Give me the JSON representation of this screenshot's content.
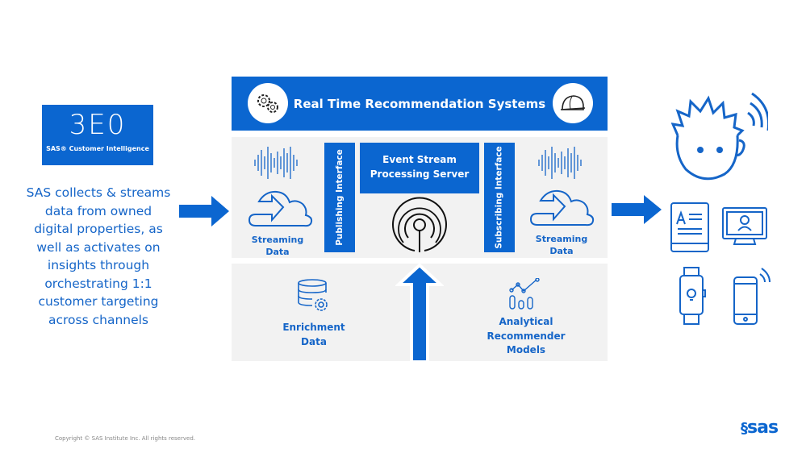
{
  "logo": {
    "mark": "3E0",
    "subtitle": "SAS® Customer Intelligence"
  },
  "left_text": [
    "SAS collects & streams",
    "data from owned",
    "digital properties, as",
    "well as activates on",
    "insights through",
    "orchestrating 1:1",
    "customer targeting",
    "across channels"
  ],
  "header": {
    "title": "Real Time Recommendation Systems",
    "left_icon": "gears-icon",
    "right_icon": "hard-hat-icon"
  },
  "streaming": {
    "left_label": [
      "Streaming",
      "Data"
    ],
    "right_label": [
      "Streaming",
      "Data"
    ]
  },
  "publishing": "Publishing Interface",
  "subscribing": "Subscribing Interface",
  "esp": [
    "Event Stream",
    "Processing Server"
  ],
  "enrichment": [
    "Enrichment",
    "Data"
  ],
  "analytical": [
    "Analytical",
    "Recommender",
    "Models"
  ],
  "footer": {
    "copyright": "Copyright © SAS Institute Inc. All rights reserved.",
    "brand": "sas"
  },
  "colors": {
    "accent": "#0b66d0",
    "panel": "#f2f2f2"
  }
}
